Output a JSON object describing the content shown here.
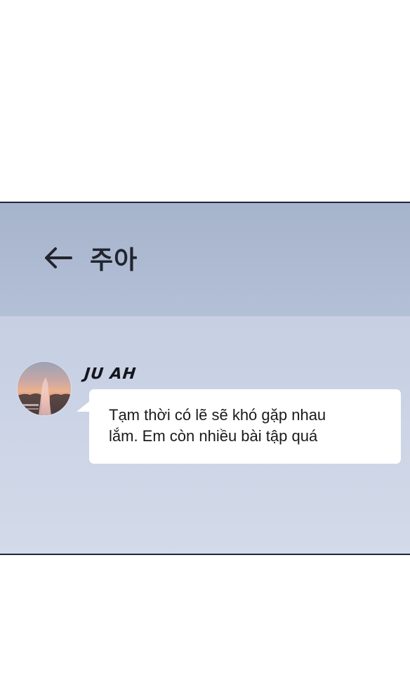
{
  "chat_header": {
    "back_icon": "arrow-left-icon",
    "title": "주아"
  },
  "message": {
    "avatar_icon": "profile-photo-sunset",
    "sender": "JU AH",
    "text": "Tạm thời có lẽ sẽ khó gặp nhau\nlắm. Em còn nhiều bài tập quá"
  },
  "colors": {
    "header_background": "#aebbd2",
    "chat_background": "#c8d1e4",
    "bubble": "#ffffff",
    "frame_border": "#1f2440"
  }
}
